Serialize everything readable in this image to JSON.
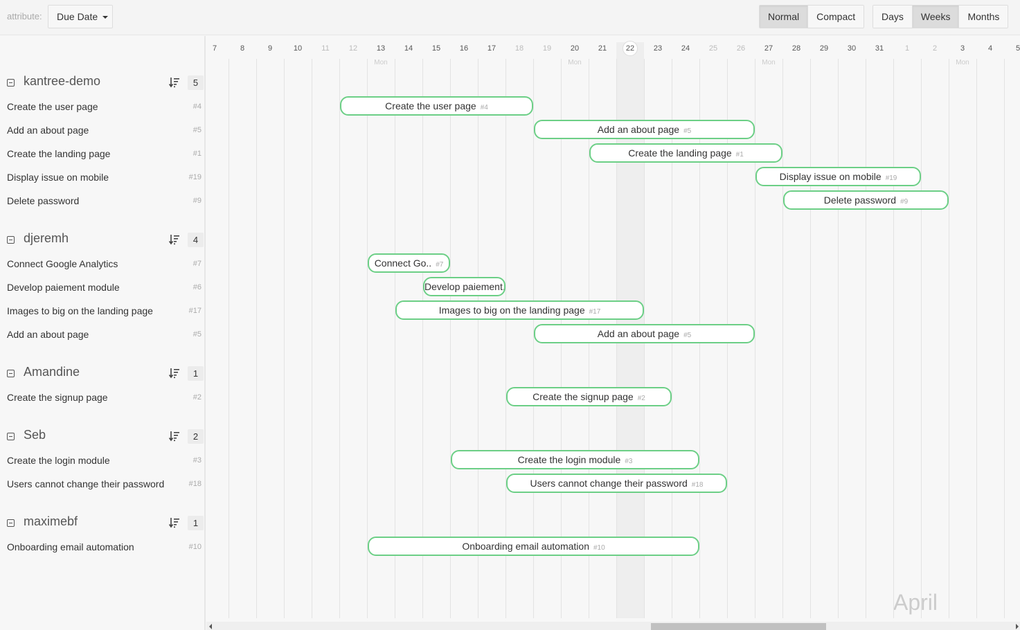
{
  "toolbar": {
    "attribute_label": "attribute:",
    "attribute_value": "Due Date",
    "density_buttons": [
      {
        "label": "Normal",
        "active": true
      },
      {
        "label": "Compact",
        "active": false
      }
    ],
    "scale_buttons": [
      {
        "label": "Days",
        "active": false
      },
      {
        "label": "Weeks",
        "active": true
      },
      {
        "label": "Months",
        "active": false
      }
    ]
  },
  "timeline": {
    "days": [
      {
        "label": "7",
        "weekend": false
      },
      {
        "label": "8",
        "weekend": false
      },
      {
        "label": "9",
        "weekend": false
      },
      {
        "label": "10",
        "weekend": false
      },
      {
        "label": "11",
        "weekend": true
      },
      {
        "label": "12",
        "weekend": true
      },
      {
        "label": "13",
        "weekend": false,
        "mon": true
      },
      {
        "label": "14",
        "weekend": false
      },
      {
        "label": "15",
        "weekend": false
      },
      {
        "label": "16",
        "weekend": false
      },
      {
        "label": "17",
        "weekend": false
      },
      {
        "label": "18",
        "weekend": true
      },
      {
        "label": "19",
        "weekend": true
      },
      {
        "label": "20",
        "weekend": false,
        "mon": true
      },
      {
        "label": "21",
        "weekend": false
      },
      {
        "label": "22",
        "weekend": false,
        "today": true
      },
      {
        "label": "23",
        "weekend": false
      },
      {
        "label": "24",
        "weekend": false
      },
      {
        "label": "25",
        "weekend": true
      },
      {
        "label": "26",
        "weekend": true
      },
      {
        "label": "27",
        "weekend": false,
        "mon": true
      },
      {
        "label": "28",
        "weekend": false
      },
      {
        "label": "29",
        "weekend": false
      },
      {
        "label": "30",
        "weekend": false
      },
      {
        "label": "31",
        "weekend": false
      },
      {
        "label": "1",
        "weekend": true
      },
      {
        "label": "2",
        "weekend": true
      },
      {
        "label": "3",
        "weekend": false,
        "mon": true
      },
      {
        "label": "4",
        "weekend": false
      },
      {
        "label": "5",
        "weekend": false
      }
    ],
    "mon_label": "Mon",
    "month_label": "April",
    "scroll_position": 0.55
  },
  "groups": [
    {
      "name": "kantree-demo",
      "count": "5",
      "tasks": [
        {
          "title": "Create the user page",
          "num": "#4",
          "bar_label": "Create the user page",
          "start": 5,
          "end": 12
        },
        {
          "title": "Add an about page",
          "num": "#5",
          "bar_label": "Add an about page",
          "start": 12,
          "end": 20
        },
        {
          "title": "Create the landing page",
          "num": "#1",
          "bar_label": "Create the landing page",
          "start": 14,
          "end": 21
        },
        {
          "title": "Display issue on mobile",
          "num": "#19",
          "bar_label": "Display issue on mobile",
          "start": 20,
          "end": 26
        },
        {
          "title": "Delete password",
          "num": "#9",
          "bar_label": "Delete password",
          "start": 21,
          "end": 27
        }
      ]
    },
    {
      "name": "djeremh",
      "count": "4",
      "tasks": [
        {
          "title": "Connect Google Analytics",
          "num": "#7",
          "bar_label": "Connect Go..",
          "start": 6,
          "end": 9
        },
        {
          "title": "Develop paiement module",
          "num": "#6",
          "bar_label": "Develop paiement...",
          "start": 8,
          "end": 11
        },
        {
          "title": "Images to big on the landing page",
          "num": "#17",
          "bar_label": "Images to big on the landing page",
          "start": 7,
          "end": 16
        },
        {
          "title": "Add an about page",
          "num": "#5",
          "bar_label": "Add an about page",
          "start": 12,
          "end": 20
        }
      ]
    },
    {
      "name": "Amandine",
      "count": "1",
      "tasks": [
        {
          "title": "Create the signup page",
          "num": "#2",
          "bar_label": "Create the signup page",
          "start": 11,
          "end": 17
        }
      ]
    },
    {
      "name": "Seb",
      "count": "2",
      "tasks": [
        {
          "title": "Create the login module",
          "num": "#3",
          "bar_label": "Create the login module",
          "start": 9,
          "end": 18
        },
        {
          "title": "Users cannot change their password",
          "num": "#18",
          "bar_label": "Users cannot change their password",
          "start": 11,
          "end": 19
        }
      ]
    },
    {
      "name": "maximebf",
      "count": "1",
      "tasks": [
        {
          "title": "Onboarding email automation",
          "num": "#10",
          "bar_label": "Onboarding email automation",
          "start": 6,
          "end": 18
        }
      ]
    }
  ],
  "colors": {
    "bar_border": "#6ccf86",
    "today_column": "#eeeeee"
  }
}
